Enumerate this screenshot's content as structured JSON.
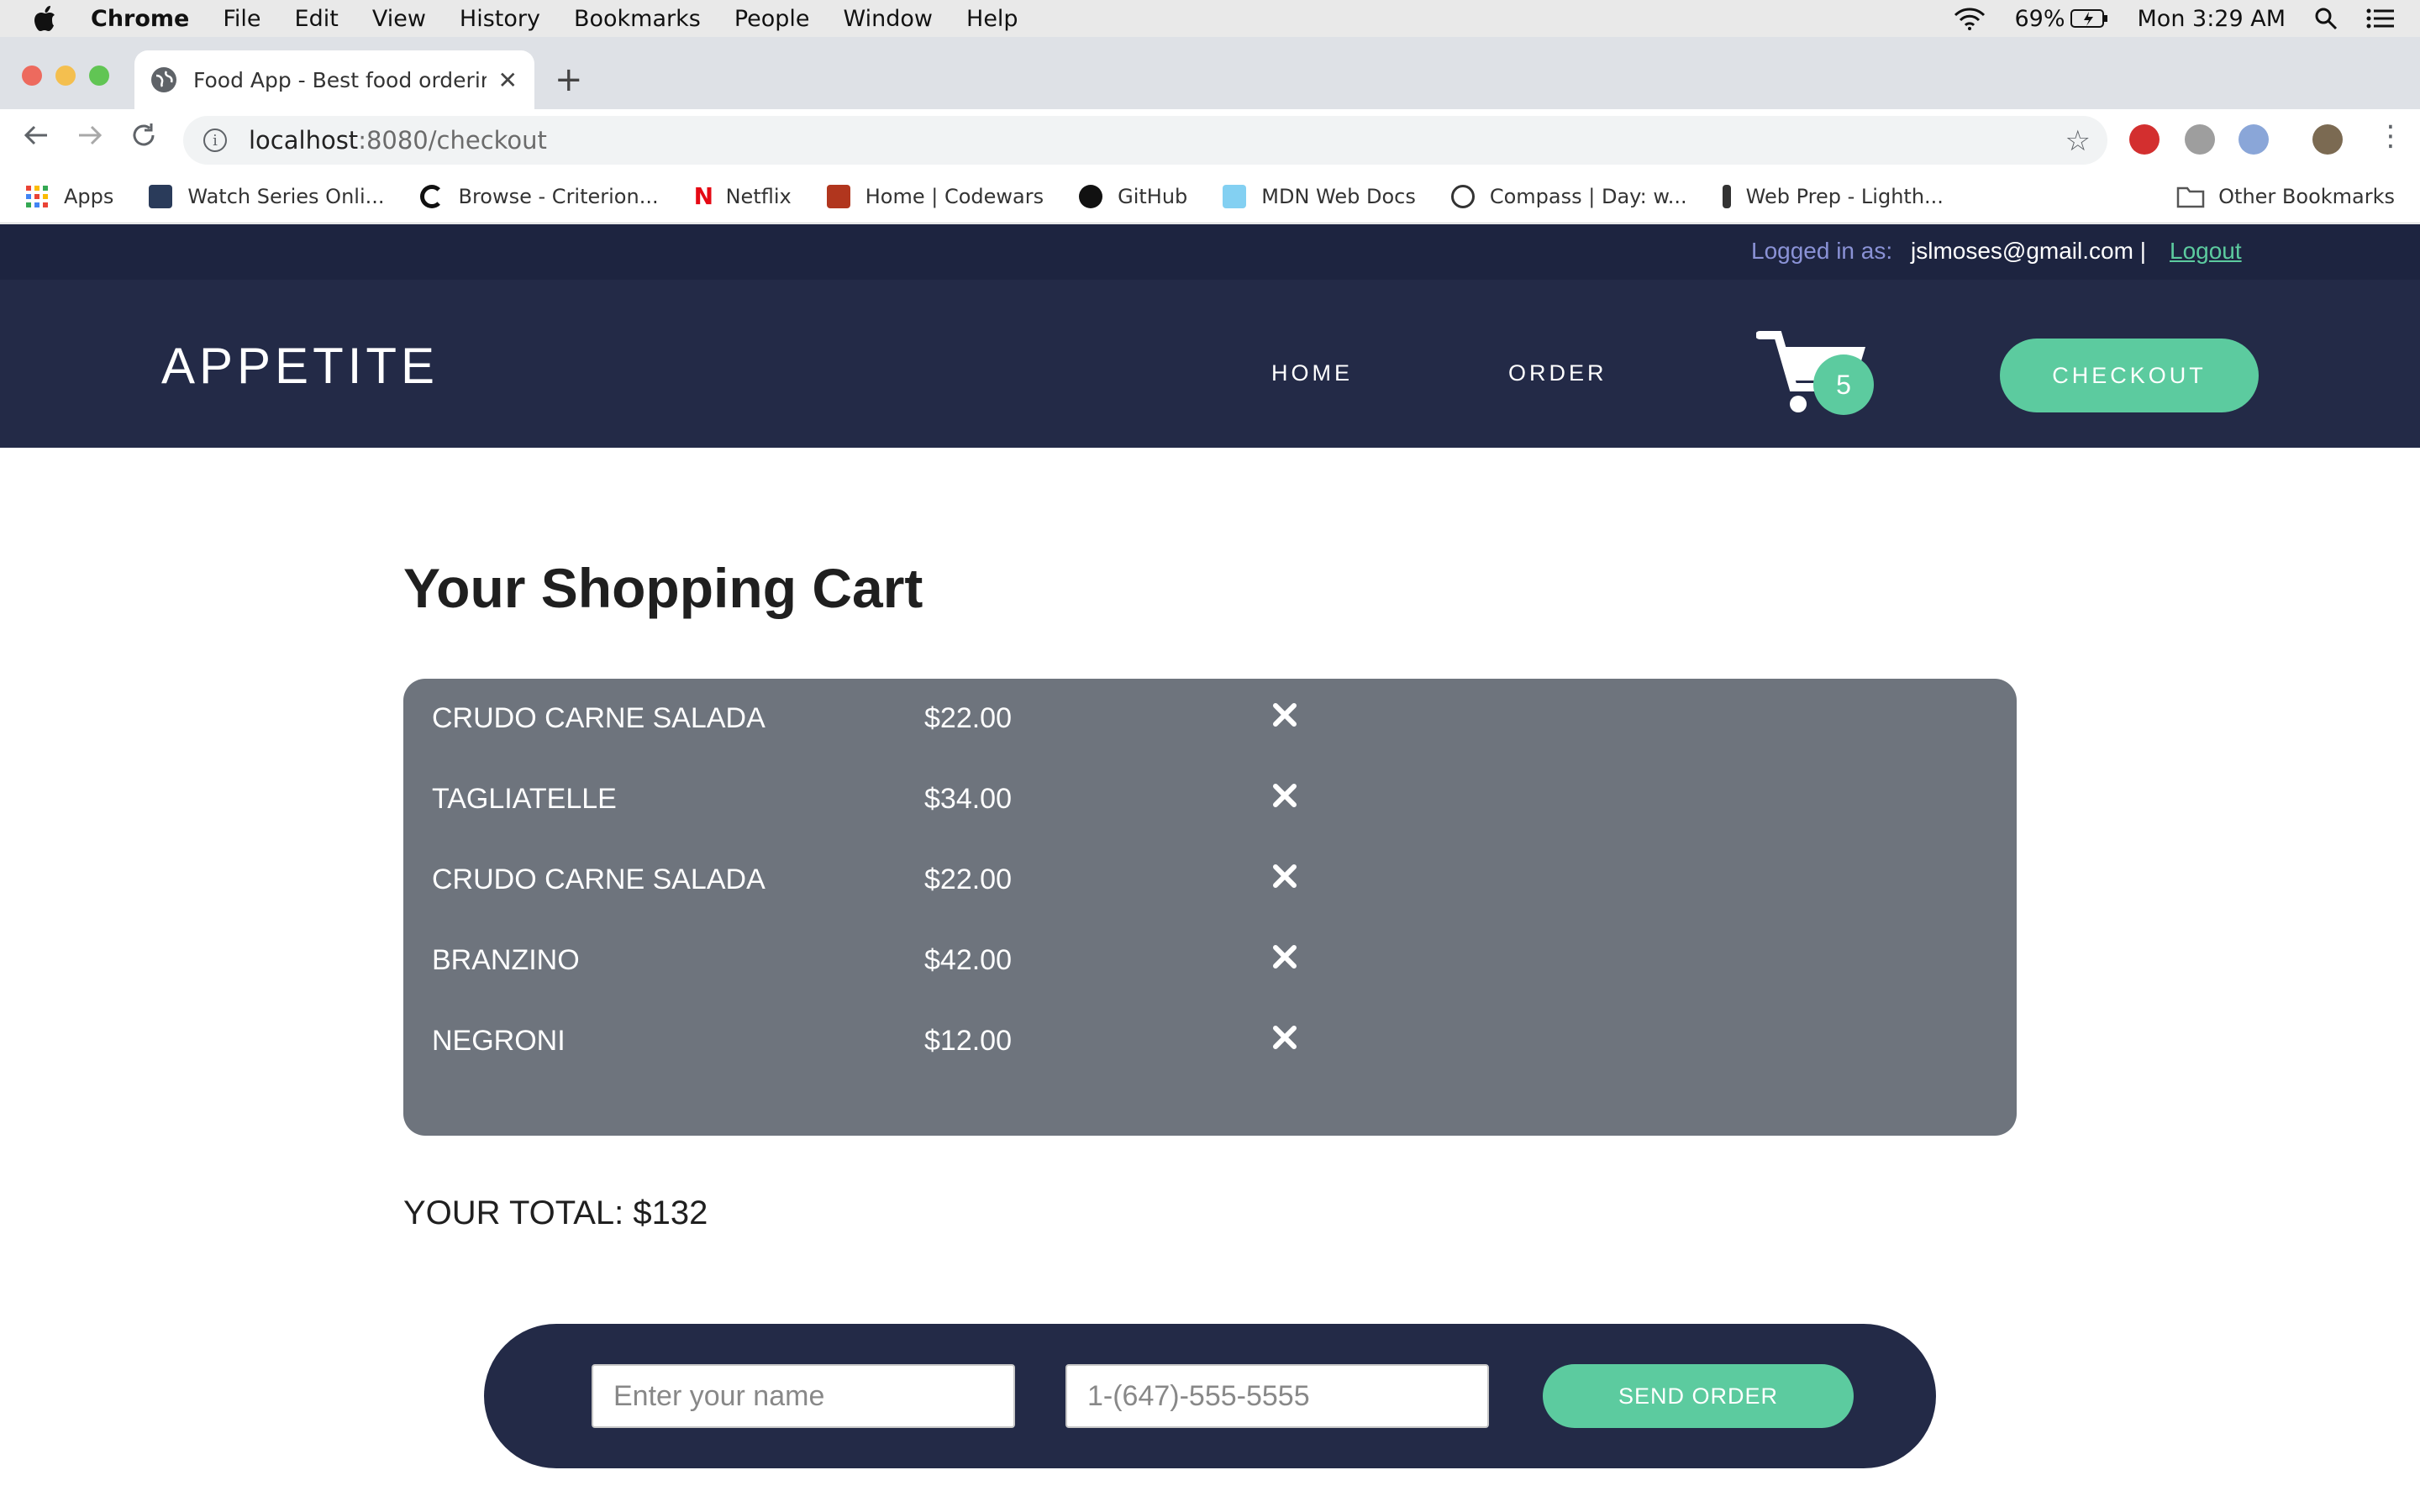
{
  "menubar": {
    "app": "Chrome",
    "items": [
      "File",
      "Edit",
      "View",
      "History",
      "Bookmarks",
      "People",
      "Window",
      "Help"
    ],
    "battery": "69%",
    "clock": "Mon 3:29 AM"
  },
  "browser": {
    "tab_title": "Food App - Best food ordering",
    "url_host": "localhost",
    "url_path": ":8080/checkout",
    "bookmarks": [
      {
        "label": "Apps",
        "icon": "apps-grid-icon",
        "color": "#e53935"
      },
      {
        "label": "Watch Series Onli...",
        "icon": "watch-series-icon",
        "color": "#2a3b5a"
      },
      {
        "label": "Browse - Criterion...",
        "icon": "criterion-icon",
        "color": "#111111"
      },
      {
        "label": "Netflix",
        "icon": "netflix-icon",
        "color": "#e50914"
      },
      {
        "label": "Home | Codewars",
        "icon": "codewars-icon",
        "color": "#b1361e"
      },
      {
        "label": "GitHub",
        "icon": "github-icon",
        "color": "#111111"
      },
      {
        "label": "MDN Web Docs",
        "icon": "mdn-icon",
        "color": "#83d0f2"
      },
      {
        "label": "Compass | Day: w...",
        "icon": "compass-icon",
        "color": "#333333"
      },
      {
        "label": "Web Prep - Lighth...",
        "icon": "lighthouse-icon",
        "color": "#333333"
      }
    ],
    "other_bookmarks": "Other Bookmarks"
  },
  "topbar": {
    "login_label": "Logged in as:",
    "email": "jslmoses@gmail.com |",
    "logout": "Logout"
  },
  "header": {
    "brand": "APPETITE",
    "nav": [
      "HOME",
      "ORDER"
    ],
    "cart_count": "5",
    "checkout": "CHECKOUT"
  },
  "cart": {
    "title": "Your Shopping Cart",
    "items": [
      {
        "name": "CRUDO CARNE SALADA",
        "price": "$22.00"
      },
      {
        "name": "TAGLIATELLE",
        "price": "$34.00"
      },
      {
        "name": "CRUDO CARNE SALADA",
        "price": "$22.00"
      },
      {
        "name": "BRANZINO",
        "price": "$42.00"
      },
      {
        "name": "NEGRONI",
        "price": "$12.00"
      }
    ],
    "total": "YOUR TOTAL: $132"
  },
  "order_form": {
    "name_placeholder": "Enter your name",
    "phone_placeholder": "1-(647)-555-5555",
    "send": "SEND ORDER"
  },
  "colors": {
    "accent": "#5ccb9f",
    "navy": "#232a47",
    "panel": "#6e747d"
  }
}
